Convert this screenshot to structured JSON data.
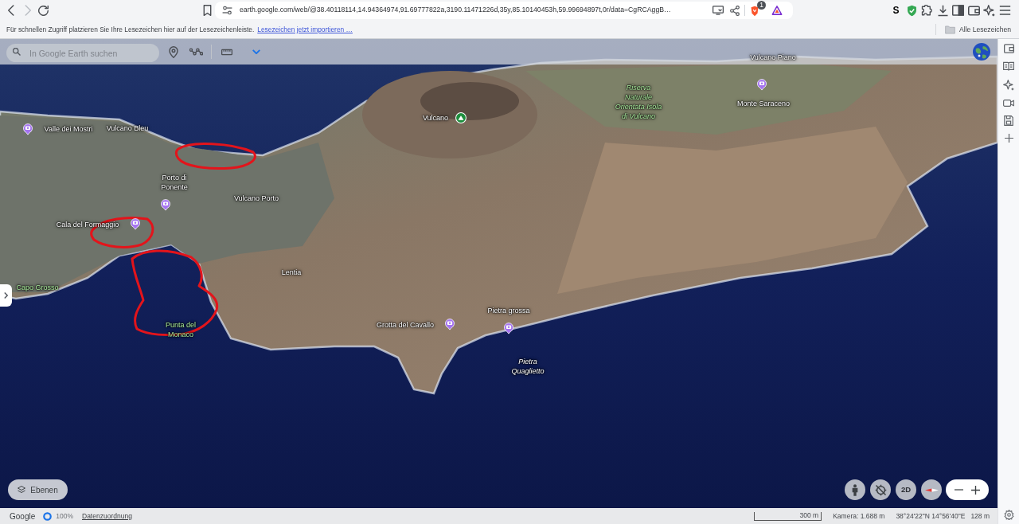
{
  "browser": {
    "nav_buttons": [
      {
        "kind": "back",
        "disabled": false
      },
      {
        "kind": "forward",
        "disabled": true
      },
      {
        "kind": "reload",
        "disabled": false
      }
    ],
    "url": "earth.google.com/web/@38.40118114,14.94364974,91.69777822a,3190.11471226d,35y,85.10140453h,59.99694897t,0r/data=CgRCAggB…",
    "shields_badge": "1",
    "extension_letter": "S"
  },
  "bookmarks_bar": {
    "hint": "Für schnellen Zugriff platzieren Sie Ihre Lesezeichen hier auf der Lesezeichenleiste.",
    "import_link": "Lesezeichen jetzt importieren …",
    "all_bookmarks": "Alle Lesezeichen"
  },
  "earth_toolbar": {
    "search": {
      "placeholder": "In Google Earth suchen"
    }
  },
  "map": {
    "labels": [
      {
        "lines": [
          "Vulcano Piano"
        ],
        "kind": "place"
      },
      {
        "lines": [
          "Riserva",
          "Naturale",
          "Orientata Isola",
          "di Vulcano"
        ],
        "kind": "nature_reserve"
      },
      {
        "lines": [
          "Monte Saraceno"
        ],
        "kind": "place",
        "marker": {
          "kind": "photo"
        }
      },
      {
        "lines": [
          "Vulcano"
        ],
        "kind": "place",
        "marker": {
          "kind": "peak"
        }
      },
      {
        "lines": [
          "Valle dei Mostri"
        ],
        "kind": "place",
        "marker": {
          "kind": "photo"
        }
      },
      {
        "lines": [
          "Vulcano Bleu"
        ],
        "kind": "place"
      },
      {
        "lines": [
          "Porto di",
          "Ponente"
        ],
        "kind": "place",
        "marker": {
          "kind": "photo"
        }
      },
      {
        "lines": [
          "Vulcano Porto"
        ],
        "kind": "place"
      },
      {
        "lines": [
          "Cala del Formaggio"
        ],
        "kind": "place",
        "marker": {
          "kind": "photo"
        }
      },
      {
        "lines": [
          "Lentia"
        ],
        "kind": "place"
      },
      {
        "lines": [
          "Capo Grosso"
        ],
        "kind": "cape"
      },
      {
        "lines": [
          "Pietra grossa"
        ],
        "kind": "place",
        "marker": {
          "kind": "photo"
        }
      },
      {
        "lines": [
          "Punta del",
          "Monaco"
        ],
        "kind": "cape"
      },
      {
        "lines": [
          "Grotta del Cavallo"
        ],
        "kind": "place",
        "marker": {
          "kind": "photo"
        }
      },
      {
        "lines": [
          "Pietra",
          "Quaglietto"
        ],
        "kind": "rock"
      }
    ]
  },
  "layers_button": {
    "label": "Ebenen"
  },
  "view_controls": {
    "view_mode": "2D"
  },
  "status_bar": {
    "brand": "Google",
    "load_percent": "100%",
    "attribution_link": "Datenzuordnung",
    "scale": "300 m",
    "camera": "Kamera: 1.688 m",
    "coordinates": "38°24'22\"N 14°56'40\"E",
    "elevation": "128 m"
  }
}
